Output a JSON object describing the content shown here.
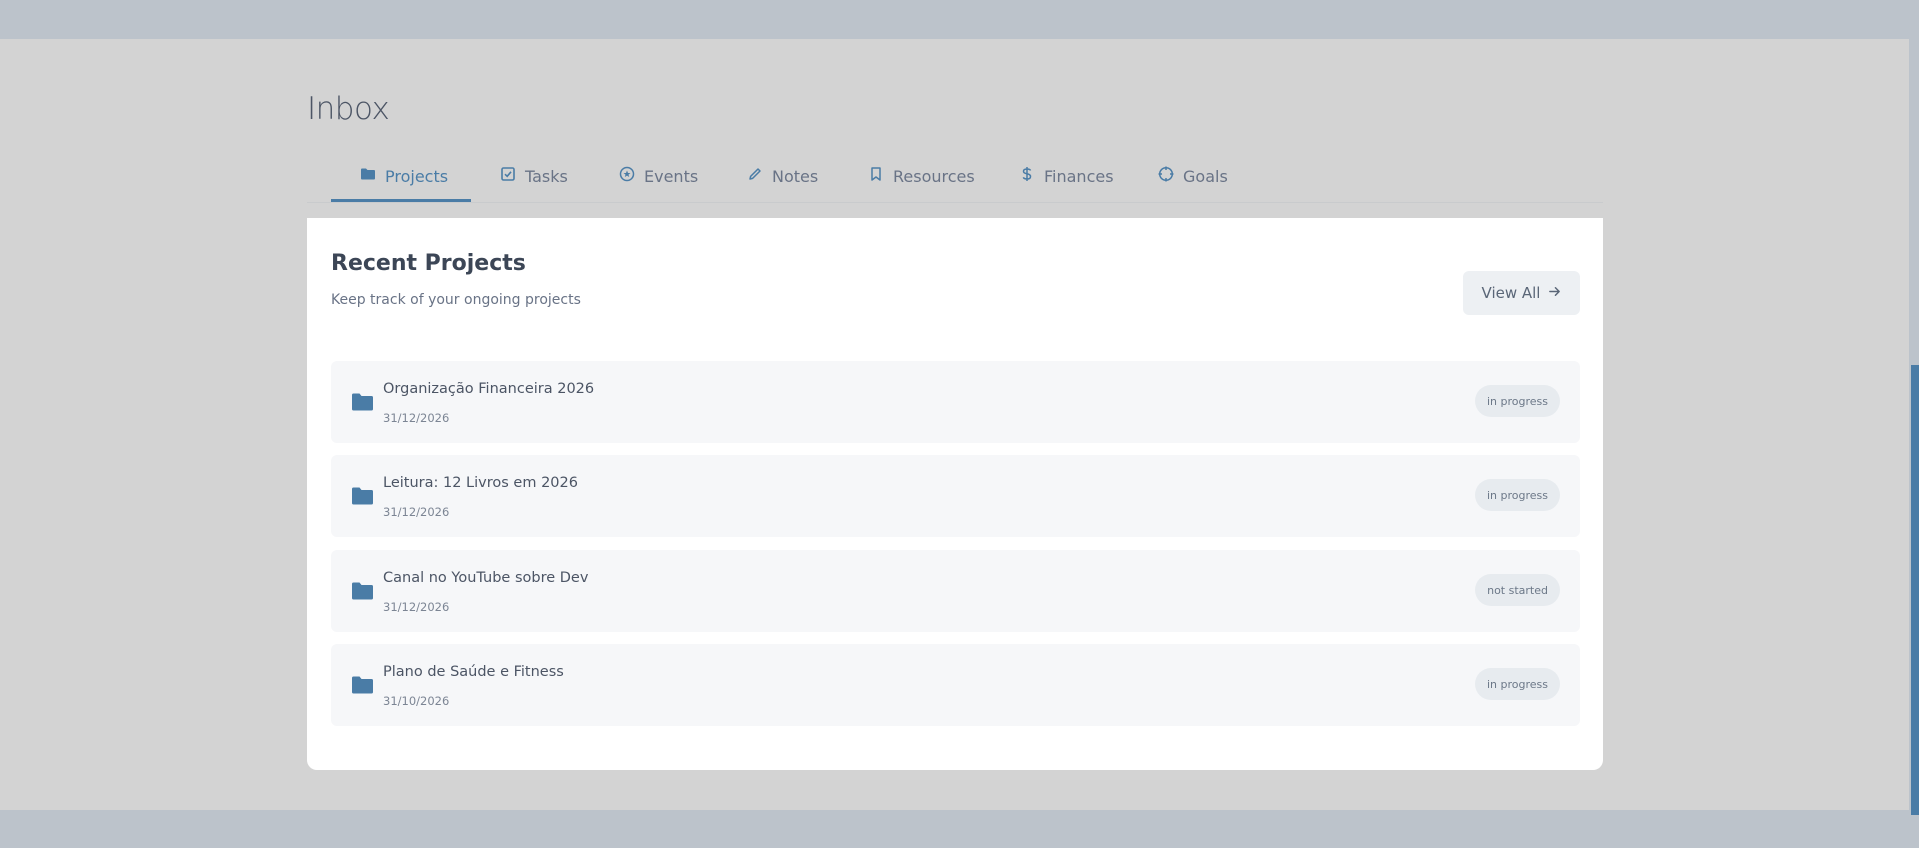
{
  "page": {
    "title": "Inbox"
  },
  "tabs": [
    {
      "label": "Projects",
      "icon": "folder-icon",
      "active": true
    },
    {
      "label": "Tasks",
      "icon": "checkbox-icon",
      "active": false
    },
    {
      "label": "Events",
      "icon": "circle-star-icon",
      "active": false
    },
    {
      "label": "Notes",
      "icon": "pencil-icon",
      "active": false
    },
    {
      "label": "Resources",
      "icon": "bookmark-icon",
      "active": false
    },
    {
      "label": "Finances",
      "icon": "dollar-icon",
      "active": false
    },
    {
      "label": "Goals",
      "icon": "target-icon",
      "active": false
    }
  ],
  "card": {
    "title": "Recent Projects",
    "subtitle": "Keep track of your ongoing projects",
    "view_all_label": "View All",
    "view_all_icon": "arrow-right-icon"
  },
  "projects": [
    {
      "name": "Organização Financeira 2026",
      "date": "31/12/2026",
      "status": "in progress"
    },
    {
      "name": "Leitura: 12 Livros em 2026",
      "date": "31/12/2026",
      "status": "in progress"
    },
    {
      "name": "Canal no YouTube sobre Dev",
      "date": "31/12/2026",
      "status": "not started"
    },
    {
      "name": "Plano de Saúde e Fitness",
      "date": "31/10/2026",
      "status": "in progress"
    }
  ],
  "colors": {
    "accent": "#4a7ca6",
    "background": "#d3d3d3",
    "chrome": "#bcc3cb",
    "card": "#ffffff",
    "row": "#f6f7f9",
    "badge": "#e7ebef"
  }
}
